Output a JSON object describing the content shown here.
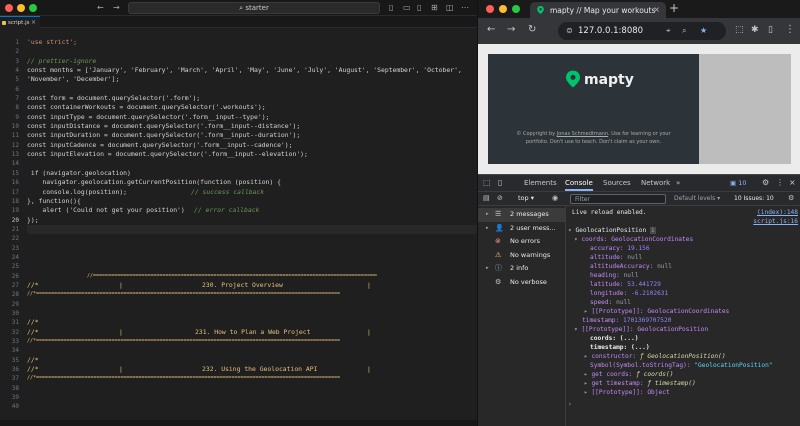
{
  "editor": {
    "search_text": "starter",
    "tab_label": "script.js",
    "line_numbers": [
      "1",
      "2",
      "3",
      "4",
      "5",
      "6",
      "7",
      "8",
      "9",
      "10",
      "11",
      "12",
      "13",
      "14",
      "15",
      "16",
      "17",
      "18",
      "19",
      "20",
      "21",
      "22",
      "23",
      "24",
      "25",
      "26",
      "27",
      "28",
      "29",
      "30",
      "31",
      "32",
      "33",
      "34",
      "35",
      "36",
      "37",
      "38",
      "39",
      "40"
    ],
    "current_line": 20,
    "code": {
      "l1": "'use strict';",
      "l3": "// prettier-ignore",
      "l4a": "const months = ['January', 'February', 'March', 'April', 'May', 'June', 'July', 'August', 'September', 'October',",
      "l4b": "'November', 'December'];",
      "l6": "const form = document.querySelector('.form');",
      "l7": "const containerWorkouts = document.querySelector('.workouts');",
      "l8": "const inputType = document.querySelector('.form__input--type');",
      "l9": "const inputDistance = document.querySelector('.form__input--distance');",
      "l10": "const inputDuration = document.querySelector('.form__input--duration');",
      "l11": "const inputCadence = document.querySelector('.form__input--cadence');",
      "l12": "const inputElevation = document.querySelector('.form__input--elevation');",
      "l14": " if (navigator.geolocation)",
      "l15": "    navigator.geolocation.getCurrentPosition(function (position) {",
      "l16a": "    console.log(position);",
      "l16b": "// success callback",
      "l17": "}, function(){",
      "l18a": "    alert ('Could not get your position')",
      "l18b": "// error callback",
      "l19": "});",
      "l26": "//=====================================================================================================",
      "l27a": "//*",
      "l27b": "|",
      "l27c": "230. Project Overview",
      "l27d": "|",
      "l28": "//*=====================================================================================================",
      "l31": "//*",
      "l32a": "//*",
      "l32b": "|",
      "l32c": "231. How to Plan a Web Project",
      "l32d": "|",
      "l33": "//*=====================================================================================================",
      "l35": "//*",
      "l36a": "//*",
      "l36b": "|",
      "l36c": "232. Using the Geolocation API",
      "l36d": "|",
      "l37": "//*====================================================================================================="
    }
  },
  "browser": {
    "tab_title": "mapty // Map your workouts",
    "url": "127.0.0.1:8080",
    "page": {
      "logo_text": "mapty",
      "copyright_pre": "© Copyright by",
      "copyright_author": "Jonas Schmedtmann",
      "copyright_post": ". Use for learning or your portfolio. Don't use to teach. Don't claim as your own."
    },
    "devtools": {
      "tabs": [
        "Elements",
        "Console",
        "Sources",
        "Network"
      ],
      "more": "»",
      "badge": "10",
      "context": "top",
      "filter_placeholder": "Filter",
      "levels": "Default levels ▾",
      "issues": "10 Issues: 10",
      "sidebar": [
        {
          "label": "2 messages",
          "icon": "list-icon",
          "sym": "☰"
        },
        {
          "label": "2 user mess...",
          "icon": "user-icon",
          "sym": "👤"
        },
        {
          "label": "No errors",
          "icon": "error-icon",
          "sym": "⊗"
        },
        {
          "label": "No warnings",
          "icon": "warning-icon",
          "sym": "⚠"
        },
        {
          "label": "2 info",
          "icon": "info-icon",
          "sym": "ⓘ"
        },
        {
          "label": "No verbose",
          "icon": "verbose-icon",
          "sym": "⚙"
        }
      ],
      "console": {
        "live_reload": "Live reload enabled.",
        "live_reload_src": "(index):148",
        "script_src": "script.js:16",
        "geo_title": "GeolocationPosition",
        "coords_label": "coords: GeolocationCoordinates",
        "accuracy_key": "accuracy:",
        "accuracy_val": "19.156",
        "altitude_key": "altitude:",
        "altitude_val": "null",
        "altacc_key": "altitudeAccuracy:",
        "altacc_val": "null",
        "heading_key": "heading:",
        "heading_val": "null",
        "latitude_key": "latitude:",
        "latitude_val": "53.441729",
        "longitude_key": "longitude:",
        "longitude_val": "-6.2102631",
        "speed_key": "speed:",
        "speed_val": "null",
        "proto_coords": "[[Prototype]]: GeolocationCoordinates",
        "timestamp_key": "timestamp:",
        "timestamp_val": "1701369707520",
        "proto_pos": "[[Prototype]]: GeolocationPosition",
        "p_coords": "coords: (...)",
        "p_timestamp": "timestamp: (...)",
        "p_ctor_key": "constructor:",
        "p_ctor_val": "ƒ GeolocationPosition()",
        "p_sym_key": "Symbol(Symbol.toStringTag):",
        "p_sym_val": "\"GeolocationPosition\"",
        "p_get_coords_key": "get coords:",
        "p_get_coords_val": "ƒ coords()",
        "p_get_ts_key": "get timestamp:",
        "p_get_ts_val": "ƒ timestamp()",
        "p_proto": "[[Prototype]]: Object",
        "prompt": "›"
      }
    }
  },
  "colors": {
    "accent": "#0078d4",
    "chrome_dark": "#35363a",
    "mapty_green": "#00c46a"
  }
}
